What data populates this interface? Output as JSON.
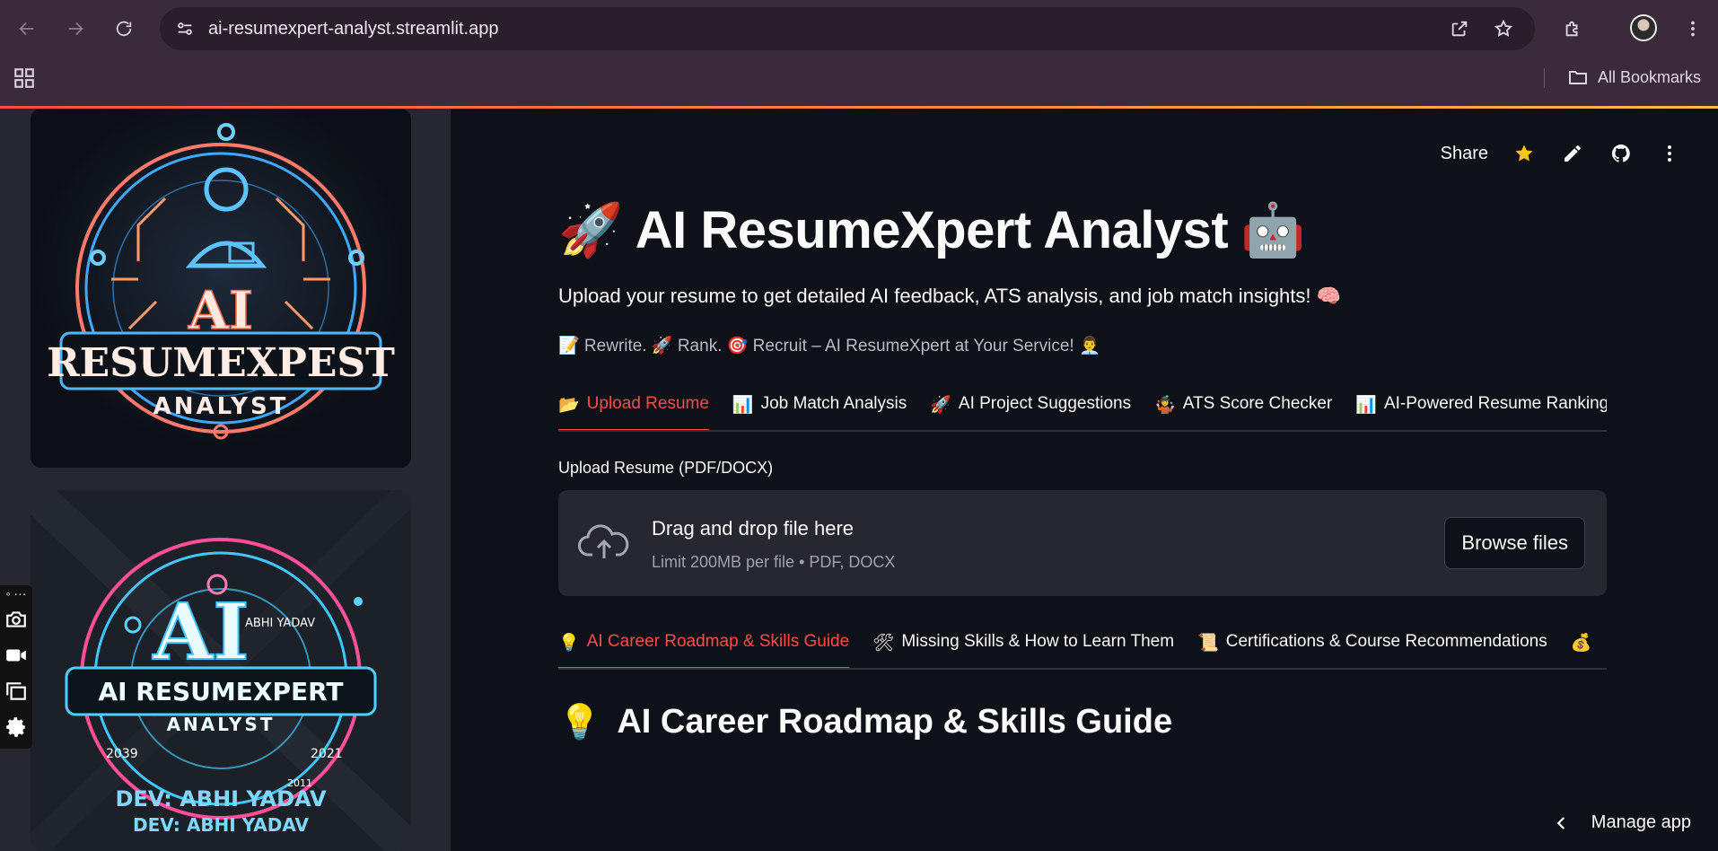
{
  "browser": {
    "url": "ai-resumexpert-analyst.streamlit.app",
    "all_bookmarks": "All Bookmarks"
  },
  "sidebar": {
    "card1": {
      "line1": "AI",
      "line2": "RESUMEXPEST",
      "line3": "ANALYST"
    },
    "card2": {
      "big": "AI",
      "small": "ABHI YADAV",
      "line1": "AI RESUMEXPERT",
      "line2": "ANALYST",
      "year_left": "2039",
      "year_right": "2021",
      "year_bottom": "2011",
      "dev1": "DEV: ABHI YADAV",
      "dev2": "DEV: ABHI YADAV"
    },
    "tools_dots": "◦ ···"
  },
  "toolbar": {
    "share": "Share"
  },
  "header": {
    "title_emoji_left": "🚀",
    "title": "AI ResumeXpert Analyst",
    "title_emoji_right": "🤖",
    "subtitle": "Upload your resume to get detailed AI feedback, ATS analysis, and job match insights! 🧠",
    "tagline": "📝 Rewrite. 🚀 Rank. 🎯 Recruit – AI ResumeXpert at Your Service! 👨‍💼"
  },
  "tabs": [
    {
      "icon": "📂",
      "label": "Upload Resume"
    },
    {
      "icon": "📊",
      "label": "Job Match Analysis"
    },
    {
      "icon": "🚀",
      "label": "AI Project Suggestions"
    },
    {
      "icon": "🤹",
      "label": "ATS Score Checker"
    },
    {
      "icon": "📊",
      "label": "AI-Powered Resume Ranking"
    }
  ],
  "upload": {
    "label": "Upload Resume (PDF/DOCX)",
    "dz_title": "Drag and drop file here",
    "dz_limit": "Limit 200MB per file • PDF, DOCX",
    "browse": "Browse files"
  },
  "subtabs": [
    {
      "icon": "💡",
      "label": "AI Career Roadmap & Skills Guide"
    },
    {
      "icon": "🛠",
      "label": "Missing Skills & How to Learn Them"
    },
    {
      "icon": "📜",
      "label": "Certifications & Course Recommendations"
    },
    {
      "icon": "💰",
      "label": ""
    }
  ],
  "section": {
    "icon": "💡",
    "title": "AI Career Roadmap & Skills Guide"
  },
  "manage": "Manage app",
  "colors": {
    "accent": "#ff4b4b",
    "background": "#0e1117",
    "sidebar": "#262730"
  }
}
